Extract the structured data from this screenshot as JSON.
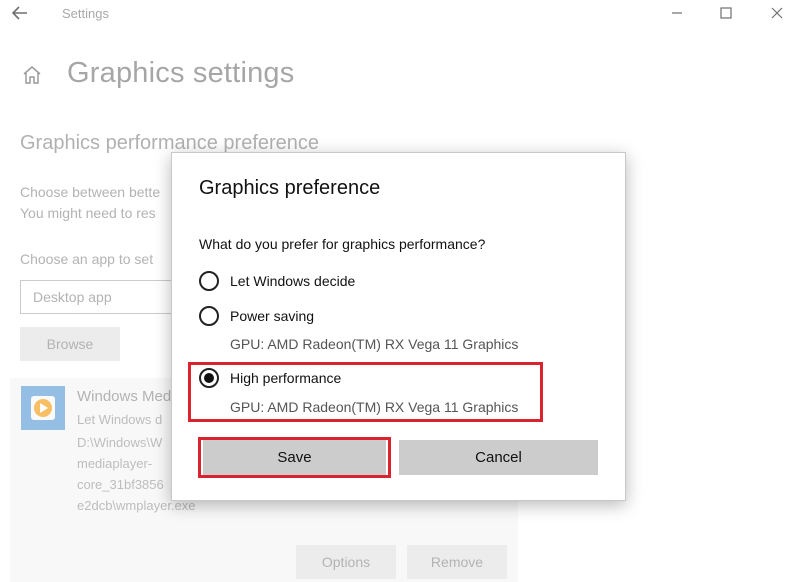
{
  "window": {
    "title": "Settings",
    "controls": [
      "minimize",
      "maximize",
      "close"
    ]
  },
  "page": {
    "title": "Graphics settings",
    "section_title": "Graphics performance preference",
    "description_lines": [
      "Choose between bette",
      "You might need to res"
    ],
    "choose_label": "Choose an app to set",
    "dropdown_value": "Desktop app",
    "browse_label": "Browse",
    "app_card": {
      "name": "Windows Med",
      "lines": [
        "Let Windows d",
        "D:\\Windows\\W",
        "mediaplayer-",
        "core_31bf3856",
        "e2dcb\\wmplayer.exe"
      ],
      "options_label": "Options",
      "remove_label": "Remove"
    }
  },
  "dialog": {
    "title": "Graphics preference",
    "question": "What do you prefer for graphics performance?",
    "options": [
      {
        "label": "Let Windows decide",
        "selected": false
      },
      {
        "label": "Power saving",
        "selected": false,
        "gpu": "GPU: AMD Radeon(TM) RX Vega 11 Graphics"
      },
      {
        "label": "High performance",
        "selected": true,
        "gpu": "GPU: AMD Radeon(TM) RX Vega 11 Graphics"
      }
    ],
    "save_label": "Save",
    "cancel_label": "Cancel"
  },
  "colors": {
    "highlight": "#d9232e",
    "button": "#cccccc",
    "app_icon": "#5b9bd5"
  }
}
